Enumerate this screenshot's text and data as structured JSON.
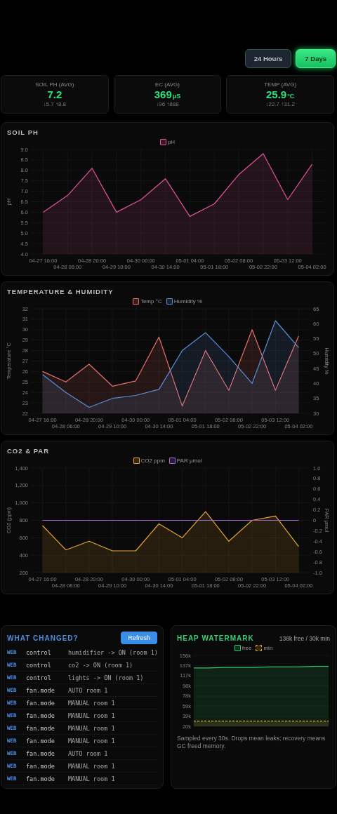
{
  "range_buttons": [
    {
      "label": "24 Hours",
      "selected": false
    },
    {
      "label": "7 Days",
      "selected": true
    }
  ],
  "stats": [
    {
      "label": "SOIL PH (AVG)",
      "value": "7.2",
      "range": "↓5.7 ↑8.8"
    },
    {
      "label": "EC (AVG)",
      "value": "369",
      "unit": "μS",
      "range": "↓96 ↑888"
    },
    {
      "label": "TEMP (AVG)",
      "value": "25.9",
      "unit": "°C",
      "range": "↓22.7 ↑31.2"
    }
  ],
  "charts": [
    {
      "title": "SOIL PH",
      "chart_data": {
        "type": "area",
        "legend": "top",
        "grid": true,
        "ylabel": "pH",
        "ylim": [
          4,
          9
        ],
        "yticks": [
          {
            "value": 4,
            "label": "4.0"
          },
          {
            "value": 4.5,
            "label": "4.5"
          },
          {
            "value": 5,
            "label": "5.0"
          },
          {
            "value": 5.5,
            "label": "5.5"
          },
          {
            "value": 6,
            "label": "6.0"
          },
          {
            "value": 6.5,
            "label": "6.5"
          },
          {
            "value": 7,
            "label": "7.0"
          },
          {
            "value": 7.5,
            "label": "7.5"
          },
          {
            "value": 8,
            "label": "8.0"
          },
          {
            "value": 8.5,
            "label": "8.5"
          },
          {
            "value": 9,
            "label": "9.0"
          }
        ],
        "categories": [
          "04-27 16:00",
          "04-28 06:00",
          "04-28 20:00",
          "04-29 10:00",
          "04-30 00:00",
          "04-30 14:00",
          "05-01 04:00",
          "05-01 18:00",
          "05-02 08:00",
          "05-02 22:00",
          "05-03 12:00",
          "05-04 02:00"
        ],
        "series": [
          {
            "name": "pH",
            "color": "#e0559a",
            "values": [
              6.0,
              6.8,
              8.1,
              6.0,
              6.6,
              7.6,
              5.8,
              6.4,
              7.8,
              8.8,
              6.6,
              8.3
            ]
          }
        ]
      }
    },
    {
      "title": "TEMPERATURE & HUMIDITY",
      "chart_data": {
        "type": "area",
        "legend": "top",
        "grid": true,
        "ylabel": "Temperature °C",
        "y2label": "Humidity %",
        "ylim": [
          22,
          32
        ],
        "y2lim": [
          30,
          65
        ],
        "yticks": [
          {
            "value": 22,
            "label": "22"
          },
          {
            "value": 23,
            "label": "23"
          },
          {
            "value": 24,
            "label": "24"
          },
          {
            "value": 25,
            "label": "25"
          },
          {
            "value": 26,
            "label": "26"
          },
          {
            "value": 27,
            "label": "27"
          },
          {
            "value": 28,
            "label": "28"
          },
          {
            "value": 29,
            "label": "29"
          },
          {
            "value": 30,
            "label": "30"
          },
          {
            "value": 31,
            "label": "31"
          },
          {
            "value": 32,
            "label": "32"
          }
        ],
        "y2ticks": [
          {
            "value": 30,
            "label": "30"
          },
          {
            "value": 35,
            "label": "35"
          },
          {
            "value": 40,
            "label": "40"
          },
          {
            "value": 45,
            "label": "45"
          },
          {
            "value": 50,
            "label": "50"
          },
          {
            "value": 55,
            "label": "55"
          },
          {
            "value": 60,
            "label": "60"
          },
          {
            "value": 65,
            "label": "65"
          }
        ],
        "categories": [
          "04-27 16:00",
          "04-28 06:00",
          "04-28 20:00",
          "04-29 10:00",
          "04-30 00:00",
          "04-30 14:00",
          "05-01 04:00",
          "05-01 18:00",
          "05-02 08:00",
          "05-02 22:00",
          "05-03 12:00",
          "05-04 02:00"
        ],
        "series": [
          {
            "name": "Temp °C",
            "color": "#e8706a",
            "values": [
              26.0,
              25.0,
              26.7,
              24.6,
              25.1,
              29.3,
              22.7,
              28.0,
              24.2,
              30.0,
              24.2,
              29.4
            ]
          },
          {
            "name": "Humidity %",
            "color": "#5b8fd8",
            "axis": "y2",
            "values": [
              43,
              37,
              32,
              35,
              36,
              38,
              51,
              57,
              49,
              40,
              61,
              52
            ]
          }
        ]
      }
    },
    {
      "title": "CO2 & PAR",
      "chart_data": {
        "type": "area",
        "legend": "top",
        "grid": true,
        "ylabel": "CO2 (ppm)",
        "y2label": "PAR μmol",
        "ylim": [
          200,
          1400
        ],
        "y2lim": [
          -1,
          1
        ],
        "yticks": [
          {
            "value": 200,
            "label": "200"
          },
          {
            "value": 400,
            "label": "400"
          },
          {
            "value": 600,
            "label": "600"
          },
          {
            "value": 800,
            "label": "800"
          },
          {
            "value": 1000,
            "label": "1,000"
          },
          {
            "value": 1200,
            "label": "1,200"
          },
          {
            "value": 1400,
            "label": "1,400"
          }
        ],
        "y2ticks": [
          {
            "value": -1,
            "label": "-1.0"
          },
          {
            "value": -0.8,
            "label": "-0.8"
          },
          {
            "value": -0.6,
            "label": "-0.6"
          },
          {
            "value": -0.4,
            "label": "-0.4"
          },
          {
            "value": -0.2,
            "label": "-0.2"
          },
          {
            "value": 0,
            "label": "0"
          },
          {
            "value": 0.2,
            "label": "0.2"
          },
          {
            "value": 0.4,
            "label": "0.4"
          },
          {
            "value": 0.6,
            "label": "0.6"
          },
          {
            "value": 0.8,
            "label": "0.8"
          },
          {
            "value": 1,
            "label": "1.0"
          }
        ],
        "categories": [
          "04-27 16:00",
          "04-28 06:00",
          "04-28 20:00",
          "04-29 10:00",
          "04-30 00:00",
          "04-30 14:00",
          "05-01 04:00",
          "05-01 18:00",
          "05-02 08:00",
          "05-02 22:00",
          "05-03 12:00",
          "05-04 02:00"
        ],
        "series": [
          {
            "name": "CO2 ppm",
            "color": "#e8a630",
            "values": [
              740,
              460,
              560,
              450,
              450,
              760,
              600,
              900,
              560,
              800,
              850,
              500
            ]
          },
          {
            "name": "PAR μmol",
            "color": "#a865d8",
            "axis": "y2",
            "type": "line",
            "values": [
              0,
              0,
              0,
              0,
              0,
              0,
              0,
              0,
              0,
              0,
              0,
              0
            ]
          }
        ]
      }
    }
  ],
  "changes": {
    "title": "WHAT CHANGED?",
    "button": "Refresh",
    "rows": [
      {
        "source": "WEB",
        "key": "control",
        "detail": "humidifier -> ON (room 1)"
      },
      {
        "source": "WEB",
        "key": "control",
        "detail": "co2 -> ON (room 1)"
      },
      {
        "source": "WEB",
        "key": "control",
        "detail": "lights -> ON (room 1)"
      },
      {
        "source": "WEB",
        "key": "fan.mode",
        "detail": "AUTO room 1"
      },
      {
        "source": "WEB",
        "key": "fan.mode",
        "detail": "MANUAL room 1"
      },
      {
        "source": "WEB",
        "key": "fan.mode",
        "detail": "MANUAL room 1"
      },
      {
        "source": "WEB",
        "key": "fan.mode",
        "detail": "MANUAL room 1"
      },
      {
        "source": "WEB",
        "key": "fan.mode",
        "detail": "MANUAL room 1"
      },
      {
        "source": "WEB",
        "key": "fan.mode",
        "detail": "AUTO room 1"
      },
      {
        "source": "WEB",
        "key": "fan.mode",
        "detail": "MANUAL room 1"
      },
      {
        "source": "WEB",
        "key": "fan.mode",
        "detail": "MANUAL room 1"
      }
    ]
  },
  "heap": {
    "title": "HEAP WATERMARK",
    "summary": "138k free / 30k min",
    "chart_data": {
      "type": "area",
      "legend": "top",
      "grid": true,
      "ylim": [
        20,
        156
      ],
      "yticks": [
        {
          "value": 20,
          "label": "20k"
        },
        {
          "value": 39,
          "label": "39k"
        },
        {
          "value": 59,
          "label": "59k"
        },
        {
          "value": 78,
          "label": "78k"
        },
        {
          "value": 98,
          "label": "98k"
        },
        {
          "value": 117,
          "label": "117k"
        },
        {
          "value": 137,
          "label": "137k"
        },
        {
          "value": 156,
          "label": "156k"
        }
      ],
      "series": [
        {
          "name": "free",
          "color": "#2ec86e",
          "values": [
            132,
            132,
            133,
            133,
            133,
            134,
            134,
            134,
            135,
            135
          ]
        },
        {
          "name": "min",
          "color": "#e8a630",
          "line_style": "dashed",
          "values": [
            30,
            30,
            30,
            30,
            30,
            30,
            30,
            30,
            30,
            30
          ]
        }
      ]
    },
    "note": "Sampled every 30s. Drops mean leaks; recovery means GC freed memory."
  }
}
